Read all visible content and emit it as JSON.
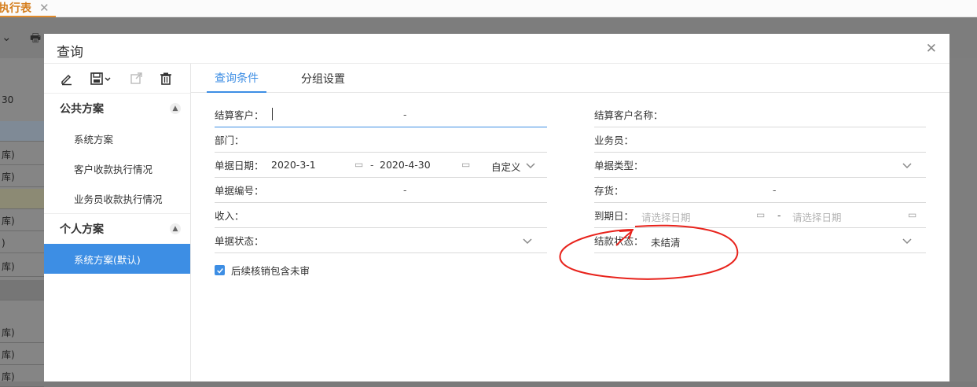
{
  "background": {
    "tab_label": "执行表",
    "tab_close": "✕",
    "row_labels": [
      "30",
      "库)",
      "库)",
      "库)",
      "库)",
      ")",
      "库)",
      "库)",
      "库)",
      "库)"
    ]
  },
  "dialog": {
    "title": "查询",
    "close": "✕"
  },
  "schemes": {
    "public_title": "公共方案",
    "public_items": [
      "系统方案",
      "客户收款执行情况",
      "业务员收款执行情况"
    ],
    "personal_title": "个人方案",
    "personal_items": [
      "系统方案(默认)"
    ]
  },
  "tabs": {
    "query": "查询条件",
    "group": "分组设置"
  },
  "form": {
    "customer_label": "结算客户：",
    "customer_name_label": "结算客户名称：",
    "dept_label": "部门：",
    "salesman_label": "业务员：",
    "date_label": "单据日期：",
    "date_from": "2020-3-1",
    "date_to": "2020-4-30",
    "date_mode": "自定义",
    "doc_type_label": "单据类型：",
    "doc_no_label": "单据编号：",
    "stock_label": "存货：",
    "income_label": "收入：",
    "due_label": "到期日：",
    "due_from_ph": "请选择日期",
    "due_to_ph": "请选择日期",
    "doc_status_label": "单据状态：",
    "settle_status_label": "结款状态：",
    "settle_status_value": "未结清",
    "dash": "-",
    "checkbox_label": "后续核销包含未审"
  },
  "colors": {
    "accent": "#3d8ee4",
    "tab_orange": "#d57d1c",
    "annotation": "#e8231c"
  }
}
